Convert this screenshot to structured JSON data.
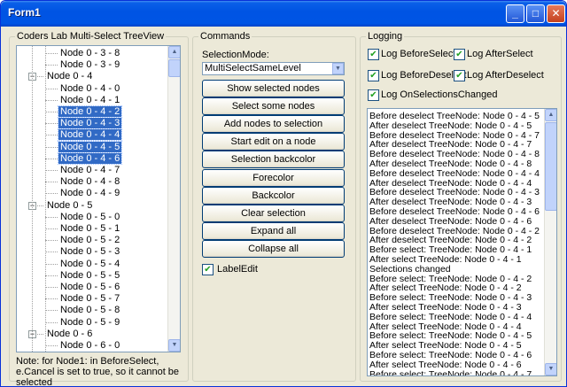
{
  "window": {
    "title": "Form1",
    "min_label": "_",
    "max_label": "□",
    "close_label": "✕"
  },
  "tree_group": {
    "title": "Coders Lab Multi-Select TreeView"
  },
  "tree_nodes": [
    {
      "label": "Node 0 - 3 - 8",
      "level": 2,
      "selected": false
    },
    {
      "label": "Node 0 - 3 - 9",
      "level": 2,
      "selected": false
    },
    {
      "label": "Node 0 - 4",
      "level": 1,
      "selected": false,
      "expander": "−"
    },
    {
      "label": "Node 0 - 4 - 0",
      "level": 2,
      "selected": false
    },
    {
      "label": "Node 0 - 4 - 1",
      "level": 2,
      "selected": false
    },
    {
      "label": "Node 0 - 4 - 2",
      "level": 2,
      "selected": true
    },
    {
      "label": "Node 0 - 4 - 3",
      "level": 2,
      "selected": true
    },
    {
      "label": "Node 0 - 4 - 4",
      "level": 2,
      "selected": true
    },
    {
      "label": "Node 0 - 4 - 5",
      "level": 2,
      "selected": true
    },
    {
      "label": "Node 0 - 4 - 6",
      "level": 2,
      "selected": true
    },
    {
      "label": "Node 0 - 4 - 7",
      "level": 2,
      "selected": false
    },
    {
      "label": "Node 0 - 4 - 8",
      "level": 2,
      "selected": false
    },
    {
      "label": "Node 0 - 4 - 9",
      "level": 2,
      "selected": false
    },
    {
      "label": "Node 0 - 5",
      "level": 1,
      "selected": false,
      "expander": "−"
    },
    {
      "label": "Node 0 - 5 - 0",
      "level": 2,
      "selected": false
    },
    {
      "label": "Node 0 - 5 - 1",
      "level": 2,
      "selected": false
    },
    {
      "label": "Node 0 - 5 - 2",
      "level": 2,
      "selected": false
    },
    {
      "label": "Node 0 - 5 - 3",
      "level": 2,
      "selected": false
    },
    {
      "label": "Node 0 - 5 - 4",
      "level": 2,
      "selected": false
    },
    {
      "label": "Node 0 - 5 - 5",
      "level": 2,
      "selected": false
    },
    {
      "label": "Node 0 - 5 - 6",
      "level": 2,
      "selected": false
    },
    {
      "label": "Node 0 - 5 - 7",
      "level": 2,
      "selected": false
    },
    {
      "label": "Node 0 - 5 - 8",
      "level": 2,
      "selected": false
    },
    {
      "label": "Node 0 - 5 - 9",
      "level": 2,
      "selected": false
    },
    {
      "label": "Node 0 - 6",
      "level": 1,
      "selected": false,
      "expander": "−"
    },
    {
      "label": "Node 0 - 6 - 0",
      "level": 2,
      "selected": false
    }
  ],
  "tree_note": "Note: for Node1: in BeforeSelect, e.Cancel is set to true, so it cannot be selected",
  "commands": {
    "title": "Commands",
    "selection_mode_label": "SelectionMode:",
    "selection_mode_value": "MultiSelectSameLevel",
    "buttons": [
      "Show selected nodes",
      "Select some nodes",
      "Add nodes to selection",
      "Start edit on a node",
      "Selection backcolor",
      "Forecolor",
      "Backcolor",
      "Clear selection",
      "Expand all",
      "Collapse all"
    ],
    "label_edit": "LabelEdit"
  },
  "logging": {
    "title": "Logging",
    "checkboxes": [
      {
        "label": "Log BeforeSelect",
        "checked": true
      },
      {
        "label": "Log AfterSelect",
        "checked": true
      },
      {
        "label": "Log BeforeDeselect",
        "checked": true
      },
      {
        "label": "Log AfterDeselect",
        "checked": true
      },
      {
        "label": "Log OnSelectionsChanged",
        "checked": true
      }
    ],
    "lines": [
      "Before deselect TreeNode: Node 0 - 4 - 5",
      "After deselect TreeNode: Node 0 - 4 - 5",
      "Before deselect TreeNode: Node 0 - 4 - 7",
      "After deselect TreeNode: Node 0 - 4 - 7",
      "Before deselect TreeNode: Node 0 - 4 - 8",
      "After deselect TreeNode: Node 0 - 4 - 8",
      "Before deselect TreeNode: Node 0 - 4 - 4",
      "After deselect TreeNode: Node 0 - 4 - 4",
      "Before deselect TreeNode: Node 0 - 4 - 3",
      "After deselect TreeNode: Node 0 - 4 - 3",
      "Before deselect TreeNode: Node 0 - 4 - 6",
      "After deselect TreeNode: Node 0 - 4 - 6",
      "Before deselect TreeNode: Node 0 - 4 - 2",
      "After deselect TreeNode: Node 0 - 4 - 2",
      "Before select: TreeNode: Node 0 - 4 - 1",
      "After select TreeNode: Node 0 - 4 - 1",
      "Selections changed",
      "Before select: TreeNode: Node 0 - 4 - 2",
      "After select TreeNode: Node 0 - 4 - 2",
      "Before select: TreeNode: Node 0 - 4 - 3",
      "After select TreeNode: Node 0 - 4 - 3",
      "Before select: TreeNode: Node 0 - 4 - 4",
      "After select TreeNode: Node 0 - 4 - 4",
      "Before select: TreeNode: Node 0 - 4 - 5",
      "After select TreeNode: Node 0 - 4 - 5",
      "Before select: TreeNode: Node 0 - 4 - 6",
      "After select TreeNode: Node 0 - 4 - 6",
      "Before select: TreeNode: Node 0 - 4 - 7"
    ]
  }
}
